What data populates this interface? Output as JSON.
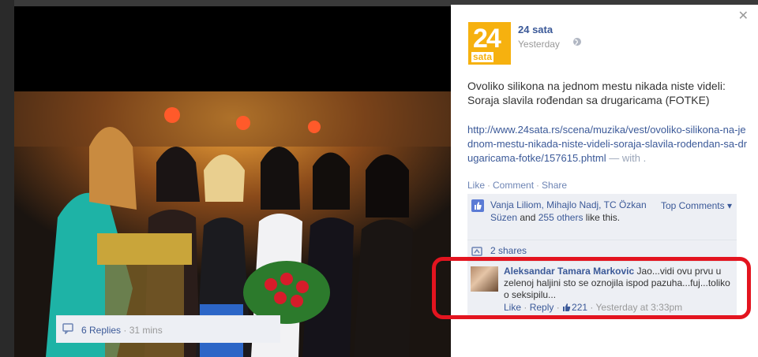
{
  "post": {
    "page_name": "24 sata",
    "logo_big": "24",
    "logo_small": "sata",
    "time": "Yesterday",
    "text": "Ovoliko silikona na jednom mestu nikada niste videli: Soraja slavila rođendan sa drugaricama (FOTKE)",
    "link": "http://www.24sata.rs/scena/muzika/vest/ovoliko-silikona-na-jednom-mestu-nikada-niste-videli-soraja-slavila-rodendan-sa-drugaricama-fotke/157615.phtml",
    "link_suffix": " — with ."
  },
  "actions": {
    "like": "Like",
    "comment": "Comment",
    "share": "Share"
  },
  "likes": {
    "names": "Vanja Liliom, Mihajlo Nadj, TC Özkan Süzen",
    "and": " and ",
    "others": "255 others",
    "tail": " like this.",
    "sort": "Top Comments ▾"
  },
  "shares": "2 shares",
  "comment": {
    "author": "Aleksandar Tamara Markovic",
    "text": " Jao...vidi ovu prvu u zelenoj haljini sto se oznojila ispod pazuha...fuj...toliko o seksipilu...",
    "like": "Like",
    "reply": "Reply",
    "count": "221",
    "time": "Yesterday at 3:33pm"
  },
  "replies": {
    "count": "6 Replies",
    "time": "31 mins"
  },
  "colors": {
    "accent": "#3b5998",
    "highlight": "#e3141f",
    "logo": "#f6b10f"
  }
}
